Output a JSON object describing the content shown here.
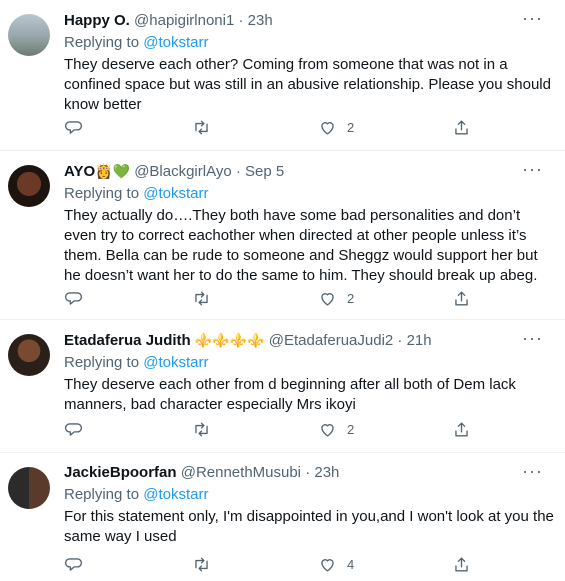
{
  "tweets": [
    {
      "name": "Happy O.",
      "badges": "",
      "handle": "@hapigirlnoni1",
      "time": "23h",
      "replying_prefix": "Replying to ",
      "replying_user": "@tokstarr",
      "text": "They deserve each other? Coming from someone that was not in a confined space but was still in an abusive relationship. Please you should know better",
      "likes": "2"
    },
    {
      "name": "AYO",
      "badges": "👸💚",
      "handle": "@BlackgirlAyo",
      "time": "Sep 5",
      "replying_prefix": "Replying to ",
      "replying_user": "@tokstarr",
      "text": "They actually do….They both have some bad personalities and don’t even try to correct eachother when directed at other people unless it’s them. Bella can be rude to someone and Sheggz would support her but he doesn’t want her to do the same to him. They should break up abeg.",
      "likes": "2"
    },
    {
      "name": "Etadaferua Judith",
      "badges": "⚜️⚜️⚜️⚜️",
      "handle": "@EtadaferuaJudi2",
      "time": "21h",
      "replying_prefix": "Replying to ",
      "replying_user": "@tokstarr",
      "text": "They deserve each other from d beginning after all both of Dem lack manners, bad character especially Mrs ikoyi",
      "likes": "2"
    },
    {
      "name": "JackieBpoorfan",
      "badges": "",
      "handle": "@RennethMusubi",
      "time": "23h",
      "replying_prefix": "Replying to ",
      "replying_user": "@tokstarr",
      "text": "For this statement only, I'm disappointed in you,and I won't look at you the same way I used",
      "likes": "4"
    }
  ],
  "separator": "·",
  "icons": [
    "more-icon",
    "reply-icon",
    "retweet-icon",
    "like-icon",
    "share-icon"
  ],
  "colors": {
    "link": "#1d9bf0",
    "secondary": "#536471",
    "text": "#0f1419"
  }
}
